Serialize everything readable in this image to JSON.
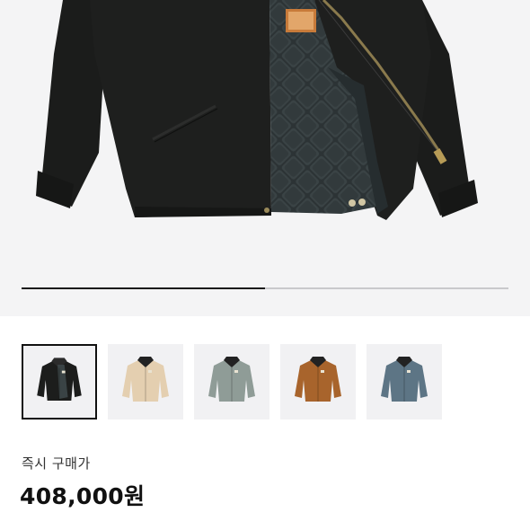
{
  "gallery": {
    "image_progress": 0.5,
    "thumbnails": [
      {
        "name": "thumb-black",
        "body": "#1c1d1c",
        "collar": "#2b2b2b",
        "selected": true
      },
      {
        "name": "thumb-beige",
        "body": "#e4cfb0",
        "collar": "#222222",
        "selected": false
      },
      {
        "name": "thumb-grey-green",
        "body": "#8f9c97",
        "collar": "#222222",
        "selected": false
      },
      {
        "name": "thumb-brown",
        "body": "#a8642c",
        "collar": "#222222",
        "selected": false
      },
      {
        "name": "thumb-blue",
        "body": "#5d7585",
        "collar": "#222222",
        "selected": false
      }
    ]
  },
  "price": {
    "label": "즉시 구매가",
    "value": "408,000원"
  },
  "colors": {
    "hero_bg": "#f4f4f5",
    "jacket_black": "#1c1d1c",
    "lining": "#2f3638",
    "accent_text": "#111111"
  }
}
